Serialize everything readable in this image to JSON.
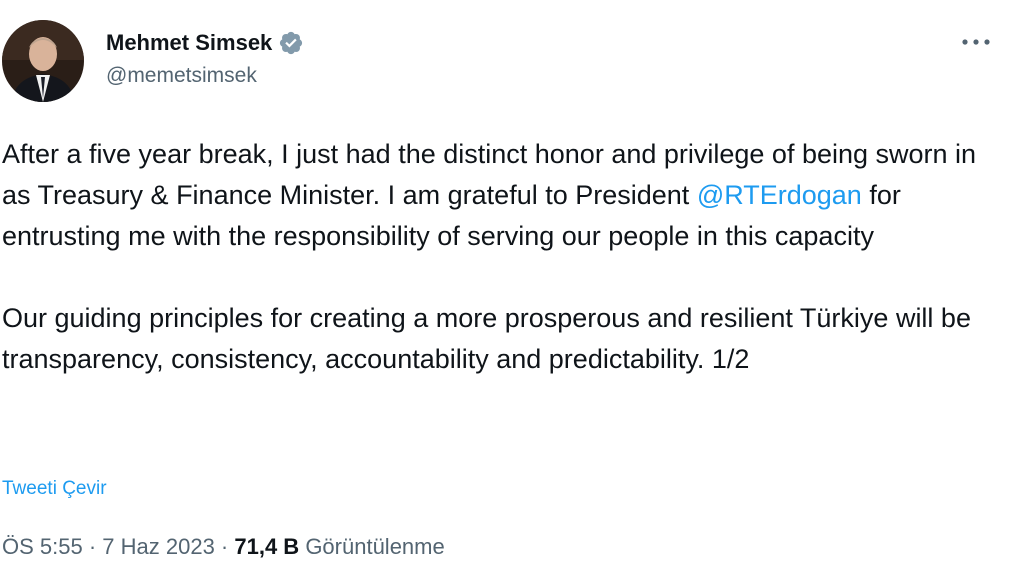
{
  "author": {
    "display_name": "Mehmet Simsek",
    "handle": "@memetsimsek",
    "verified_icon": "verified-badge-icon",
    "avatar_icon": "profile-photo"
  },
  "menu": {
    "more_icon": "more-horizontal-icon"
  },
  "tweet": {
    "p1_before": "After a five year break, I just had the distinct honor and privilege of being sworn in as Treasury & Finance Minister. I am grateful to President ",
    "mention": "@RTErdogan",
    "p1_after": " for entrusting me with the responsibility of serving our people in this capacity",
    "p2": "Our guiding principles for creating a more prosperous and resilient Türkiye will be transparency, consistency, accountability and predictability. 1/2"
  },
  "translate_label": "Tweeti Çevir",
  "meta": {
    "time": "ÖS 5:55",
    "sep1": " · ",
    "date": "7 Haz 2023",
    "sep2": " · ",
    "views_count": "71,4 B",
    "views_label": " Görüntülenme"
  },
  "colors": {
    "accent": "#1d9bf0",
    "text": "#0f1419",
    "secondary": "#536471"
  }
}
